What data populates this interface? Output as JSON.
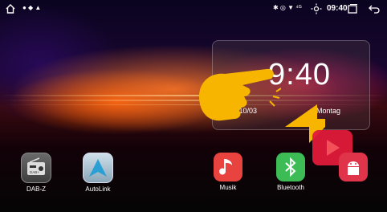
{
  "status_bar": {
    "home_icon": "home-icon",
    "left_icons": "● ◆ ▲",
    "indicators": "✱ ◎ ▼ ⁴ᴳ",
    "time": "09:40",
    "brightness_icon": "brightness-icon",
    "recent_icon": "recent-apps-icon",
    "back_icon": "back-icon"
  },
  "clock_widget": {
    "time": "9:40",
    "date": "22/10/03",
    "day": "Montag"
  },
  "apps": [
    {
      "label": "DAB-Z",
      "icon": "radio-icon",
      "color": "#5a5a5a"
    },
    {
      "label": "AutoLink",
      "icon": "autolink-icon",
      "color": "#9fb6c6"
    },
    {
      "label": "Musik",
      "icon": "music-note-icon",
      "color": "#e8433f"
    },
    {
      "label": "Bluetooth",
      "icon": "bluetooth-icon",
      "color": "#3dbb55"
    },
    {
      "label": "",
      "icon": "android-icon",
      "color": "#e0344a"
    }
  ],
  "colors": {
    "hand": "#f7b500",
    "pointer": "#e01a3a"
  }
}
